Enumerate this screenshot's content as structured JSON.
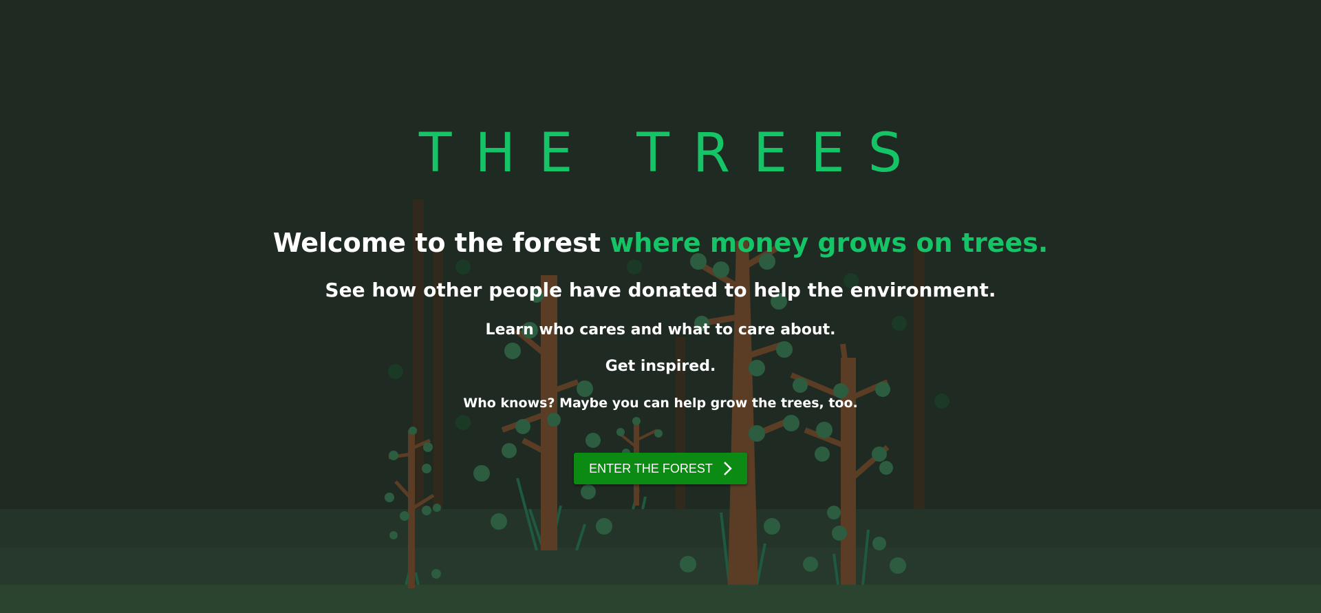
{
  "hero": {
    "title": "THE TREES",
    "headline_start": "Welcome to the forest",
    "headline_accent": "where money grows on trees.",
    "line2": "See how other people have donated to help the environment.",
    "line3": "Learn who cares and what to care about.",
    "line4": "Get inspired.",
    "line5": "Who knows? Maybe you can help grow the trees, too.",
    "cta_label": "ENTER THE FOREST",
    "cta_icon": "chevron-right-icon"
  },
  "colors": {
    "background": "#1f2a22",
    "accent": "#14c466",
    "button": "#0b8a14",
    "trunk": "#5a3d24",
    "leaf": "#2c5d41",
    "ground": "#2a3c2f"
  }
}
